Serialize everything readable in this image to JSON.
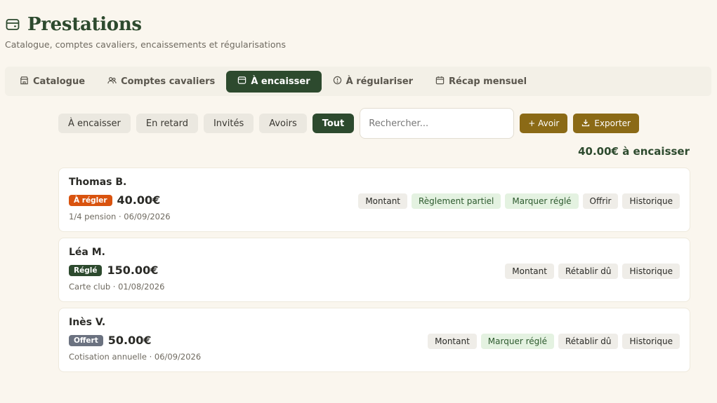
{
  "header": {
    "title": "Prestations",
    "subtitle": "Catalogue, comptes cavaliers, encaissements et régularisations"
  },
  "tabs": [
    {
      "label": "Catalogue",
      "icon": "store-icon",
      "active": false
    },
    {
      "label": "Comptes cavaliers",
      "icon": "users-icon",
      "active": false
    },
    {
      "label": "À encaisser",
      "icon": "wallet-icon",
      "active": true
    },
    {
      "label": "À régulariser",
      "icon": "clock-icon",
      "active": false
    },
    {
      "label": "Récap mensuel",
      "icon": "calendar-icon",
      "active": false
    }
  ],
  "filters": {
    "chips": [
      {
        "label": "À encaisser",
        "active": false
      },
      {
        "label": "En retard",
        "active": false
      },
      {
        "label": "Invités",
        "active": false
      },
      {
        "label": "Avoirs",
        "active": false
      },
      {
        "label": "Tout",
        "active": true
      }
    ],
    "search_placeholder": "Rechercher...",
    "add_credit_label": "+ Avoir",
    "export_label": "Exporter"
  },
  "total_label": "40.00€ à encaisser",
  "colors": {
    "primary": "#2d4a2e",
    "gold": "#8b6a16",
    "badge_due": "#d9530f",
    "badge_paid": "#2d4a2e",
    "badge_offered": "#6b7280"
  },
  "items": [
    {
      "name": "Thomas B.",
      "badge": "À régler",
      "badge_color": "#d9530f",
      "amount": "40.00€",
      "meta": "1/4 pension · 06/09/2026",
      "actions": [
        {
          "label": "Montant",
          "variant": "gray"
        },
        {
          "label": "Règlement partiel",
          "variant": "green"
        },
        {
          "label": "Marquer réglé",
          "variant": "green"
        },
        {
          "label": "Offrir",
          "variant": "gray"
        },
        {
          "label": "Historique",
          "variant": "gray"
        }
      ]
    },
    {
      "name": "Léa M.",
      "badge": "Réglé",
      "badge_color": "#2d4a2e",
      "amount": "150.00€",
      "meta": "Carte club · 01/08/2026",
      "actions": [
        {
          "label": "Montant",
          "variant": "gray"
        },
        {
          "label": "Rétablir dû",
          "variant": "gray"
        },
        {
          "label": "Historique",
          "variant": "gray"
        }
      ]
    },
    {
      "name": "Inès V.",
      "badge": "Offert",
      "badge_color": "#6b7280",
      "amount": "50.00€",
      "meta": "Cotisation annuelle · 06/09/2026",
      "actions": [
        {
          "label": "Montant",
          "variant": "gray"
        },
        {
          "label": "Marquer réglé",
          "variant": "green"
        },
        {
          "label": "Rétablir dû",
          "variant": "gray"
        },
        {
          "label": "Historique",
          "variant": "gray"
        }
      ]
    }
  ]
}
